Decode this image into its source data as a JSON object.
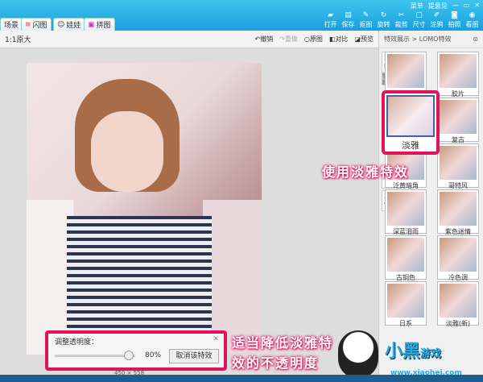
{
  "titlebar": {
    "tabs": [
      "场景",
      "闪图",
      "娃娃",
      "拼图"
    ],
    "menu": "菜单",
    "feedback": "提意见",
    "tools": [
      "打开",
      "保存",
      "抠图",
      "旋转",
      "裁剪",
      "尺寸",
      "涂鸦",
      "拍照",
      "看图"
    ]
  },
  "toolbar": {
    "zoom": "1:1原大",
    "undo": "撤销",
    "redo": "重做",
    "original": "原图",
    "compare": "对比",
    "preview": "预览"
  },
  "panel": {
    "breadcrumb": "特效展示 > LOMO特效",
    "side_tabs": [
      "热门",
      "LOMO",
      "黑白",
      "其他"
    ],
    "effects": [
      {
        "label": "",
        "col": 1
      },
      {
        "label": "胶片"
      },
      {
        "label": "淡雅",
        "selected": true
      },
      {
        "label": "复古"
      },
      {
        "label": "泛黄暗角"
      },
      {
        "label": "哥特风"
      },
      {
        "label": "深蓝泪雨"
      },
      {
        "label": "紫色迷情"
      },
      {
        "label": "古铜色"
      },
      {
        "label": "冷色调"
      },
      {
        "label": "日系"
      },
      {
        "label": "淡雅(新)"
      }
    ]
  },
  "opacity": {
    "title": "调整透明度：",
    "value_text": "80%",
    "value": 80,
    "cancel": "取消该特效"
  },
  "image_size": "450 × 558",
  "captions": {
    "use": "使用淡雅特效",
    "lower1": "适当降低淡雅特",
    "lower2": "效的不透明度"
  },
  "logo": {
    "text": "小黑游戏",
    "url": "www.xiaohei.com"
  },
  "accent": "#e0135e"
}
